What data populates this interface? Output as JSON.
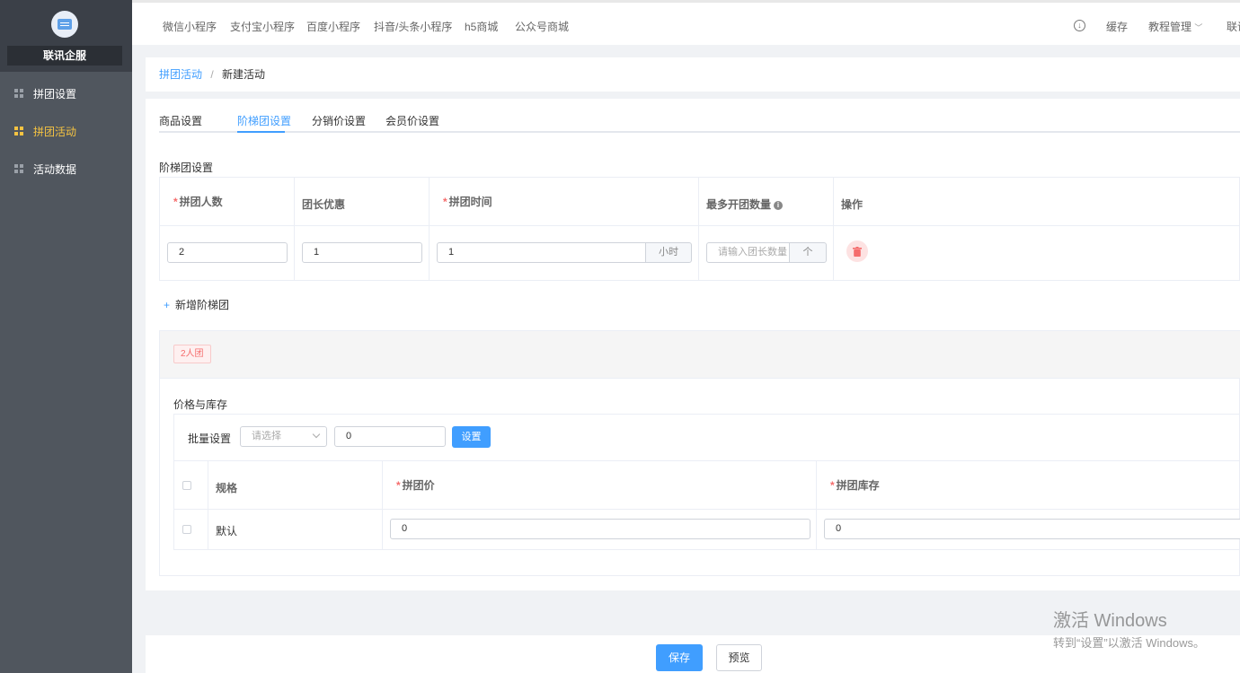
{
  "sidebar": {
    "brand": "联讯企服",
    "items": [
      {
        "label": "拼团设置",
        "icon": "grid-icon"
      },
      {
        "label": "拼团活动",
        "icon": "grid-icon",
        "active": true
      },
      {
        "label": "活动数据",
        "icon": "grid-icon"
      }
    ]
  },
  "topbar": {
    "channels": [
      "微信小程序",
      "支付宝小程序",
      "百度小程序",
      "抖音/头条小程序",
      "h5商城",
      "公众号商城"
    ],
    "cache": "缓存",
    "tutorial": "教程管理",
    "more": "联讯"
  },
  "breadcrumb": {
    "parent": "拼团活动",
    "separator": "/",
    "current": "新建活动"
  },
  "tabs": [
    "商品设置",
    "阶梯团设置",
    "分销价设置",
    "会员价设置"
  ],
  "active_tab": "阶梯团设置",
  "ladder": {
    "section_title": "阶梯团设置",
    "headers": {
      "group_size": "拼团人数",
      "leader_discount": "团长优惠",
      "duration": "拼团时间",
      "max_groups": "最多开团数量",
      "actions": "操作"
    },
    "row": {
      "group_size": "2",
      "leader_discount": "1",
      "duration": "1",
      "duration_unit": "小时",
      "max_groups_placeholder": "请输入团长数量",
      "max_groups_unit": "个"
    },
    "add_label": "新增阶梯团"
  },
  "group_tag": "2人团",
  "price_stock": {
    "title": "价格与库存",
    "batch_label": "批量设置",
    "select_placeholder": "请选择",
    "batch_value": "0",
    "set_button": "设置",
    "headers": {
      "spec": "规格",
      "group_price": "拼团价",
      "group_stock": "拼团库存"
    },
    "rows": [
      {
        "spec": "默认",
        "group_price": "0",
        "group_stock": "0"
      }
    ]
  },
  "footer": {
    "save": "保存",
    "preview": "预览"
  },
  "watermark": {
    "line1": "激活 Windows",
    "line2": "转到“设置”以激活 Windows。"
  },
  "colors": {
    "primary": "#409eff",
    "sidebar": "#50565e",
    "active_nav": "#f5c342",
    "danger": "#f56c6c"
  }
}
